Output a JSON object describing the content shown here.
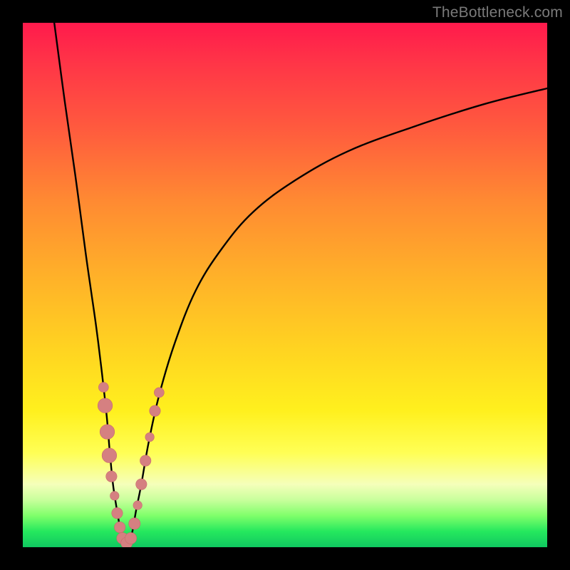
{
  "attribution": "TheBottleneck.com",
  "colors": {
    "frame": "#000000",
    "curve": "#000000",
    "marker_fill": "#d58081",
    "marker_stroke": "#c86a6c"
  },
  "chart_data": {
    "type": "line",
    "title": "",
    "xlabel": "",
    "ylabel": "",
    "xlim": [
      0,
      100
    ],
    "ylim": [
      0,
      100
    ],
    "grid": false,
    "legend": false,
    "series": [
      {
        "name": "left-branch",
        "x": [
          6,
          8,
          10,
          12,
          13,
          14,
          15,
          16,
          16.6,
          17.2,
          17.8,
          18.3,
          18.7,
          19.0
        ],
        "y": [
          100,
          85,
          71,
          56,
          49,
          42,
          34,
          25,
          18,
          12,
          8,
          5,
          2.5,
          0.8
        ]
      },
      {
        "name": "right-branch",
        "x": [
          20.2,
          20.9,
          21.6,
          22.6,
          24,
          26,
          29,
          33,
          38,
          44,
          52,
          62,
          74,
          88,
          100
        ],
        "y": [
          0.8,
          3,
          7,
          12,
          20,
          29,
          39,
          49,
          57,
          64,
          70,
          75.5,
          80,
          84.5,
          87.5
        ]
      },
      {
        "name": "valley-floor",
        "x": [
          19.0,
          19.6,
          20.2
        ],
        "y": [
          0.8,
          0.5,
          0.8
        ]
      }
    ],
    "markers": [
      {
        "x": 15.4,
        "y": 30.5,
        "r": 0.95
      },
      {
        "x": 15.7,
        "y": 27.0,
        "r": 1.4
      },
      {
        "x": 16.1,
        "y": 22.0,
        "r": 1.4
      },
      {
        "x": 16.5,
        "y": 17.5,
        "r": 1.4
      },
      {
        "x": 16.9,
        "y": 13.5,
        "r": 1.05
      },
      {
        "x": 17.5,
        "y": 9.8,
        "r": 0.85
      },
      {
        "x": 18.0,
        "y": 6.5,
        "r": 1.05
      },
      {
        "x": 18.5,
        "y": 3.8,
        "r": 1.05
      },
      {
        "x": 19.0,
        "y": 1.7,
        "r": 1.1
      },
      {
        "x": 19.8,
        "y": 0.8,
        "r": 1.1
      },
      {
        "x": 20.6,
        "y": 1.7,
        "r": 1.1
      },
      {
        "x": 21.3,
        "y": 4.5,
        "r": 1.1
      },
      {
        "x": 21.9,
        "y": 8.0,
        "r": 0.85
      },
      {
        "x": 22.6,
        "y": 12.0,
        "r": 1.05
      },
      {
        "x": 23.4,
        "y": 16.5,
        "r": 1.05
      },
      {
        "x": 24.2,
        "y": 21.0,
        "r": 0.85
      },
      {
        "x": 25.2,
        "y": 26.0,
        "r": 1.05
      },
      {
        "x": 26.0,
        "y": 29.5,
        "r": 0.95
      }
    ]
  }
}
